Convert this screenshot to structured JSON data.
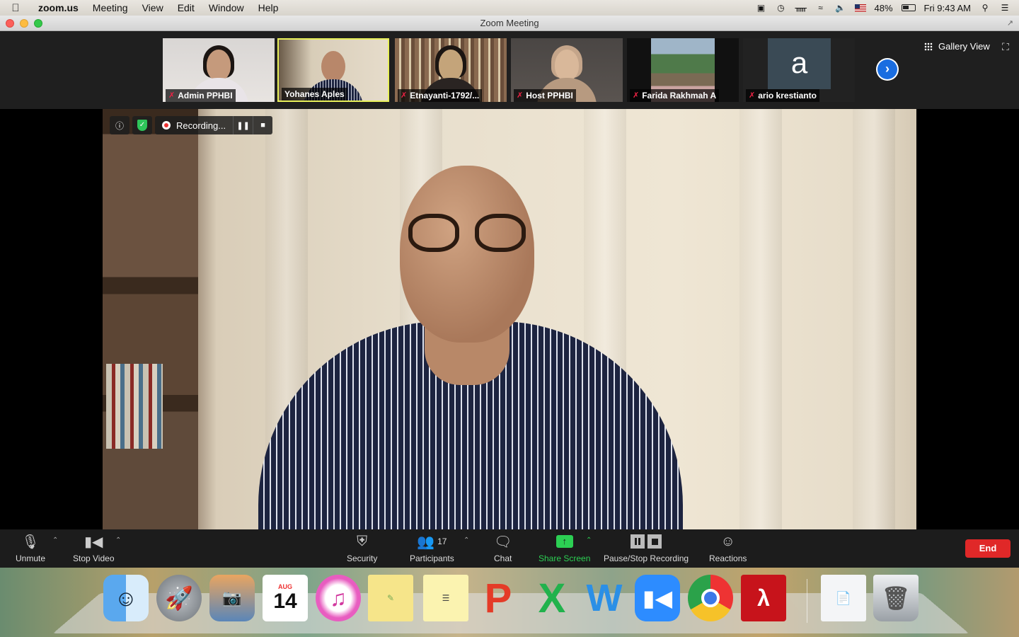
{
  "menubar": {
    "app": "zoom.us",
    "items": [
      "Meeting",
      "View",
      "Edit",
      "Window",
      "Help"
    ],
    "battery": "48%",
    "clock": "Fri 9:43 AM"
  },
  "window": {
    "title": "Zoom Meeting"
  },
  "thumbnails": [
    {
      "name": "Admin PPHBI",
      "muted": true,
      "active": false
    },
    {
      "name": "Yohanes Aples",
      "muted": false,
      "active": true
    },
    {
      "name": "Etnayanti-1792/...",
      "muted": true,
      "active": false
    },
    {
      "name": "Host PPHBI",
      "muted": true,
      "active": false
    },
    {
      "name": "Farida Rakhmah A",
      "muted": true,
      "active": false
    },
    {
      "name": "ario krestianto",
      "muted": true,
      "active": false,
      "avatar_letter": "a"
    }
  ],
  "gallery_view": "Gallery View",
  "recording": {
    "label": "Recording..."
  },
  "controls": {
    "unmute": "Unmute",
    "stop_video": "Stop Video",
    "security": "Security",
    "participants": "Participants",
    "participants_count": "17",
    "chat": "Chat",
    "share_screen": "Share Screen",
    "pause_stop_recording": "Pause/Stop Recording",
    "reactions": "Reactions",
    "end": "End"
  },
  "dock": {
    "calendar_month": "AUG",
    "calendar_day": "14",
    "items": [
      "Finder",
      "Launchpad",
      "Photos",
      "Calendar",
      "iTunes",
      "Stickies",
      "Notes",
      "PowerPoint",
      "Excel",
      "Word",
      "Zoom",
      "Chrome",
      "Acrobat",
      "Document",
      "Trash"
    ]
  },
  "colors": {
    "active_border": "#e8f05a",
    "share_green": "#2ccf53",
    "end_red": "#e02828",
    "muted_red": "#e22244",
    "next_blue": "#1a6de0"
  }
}
